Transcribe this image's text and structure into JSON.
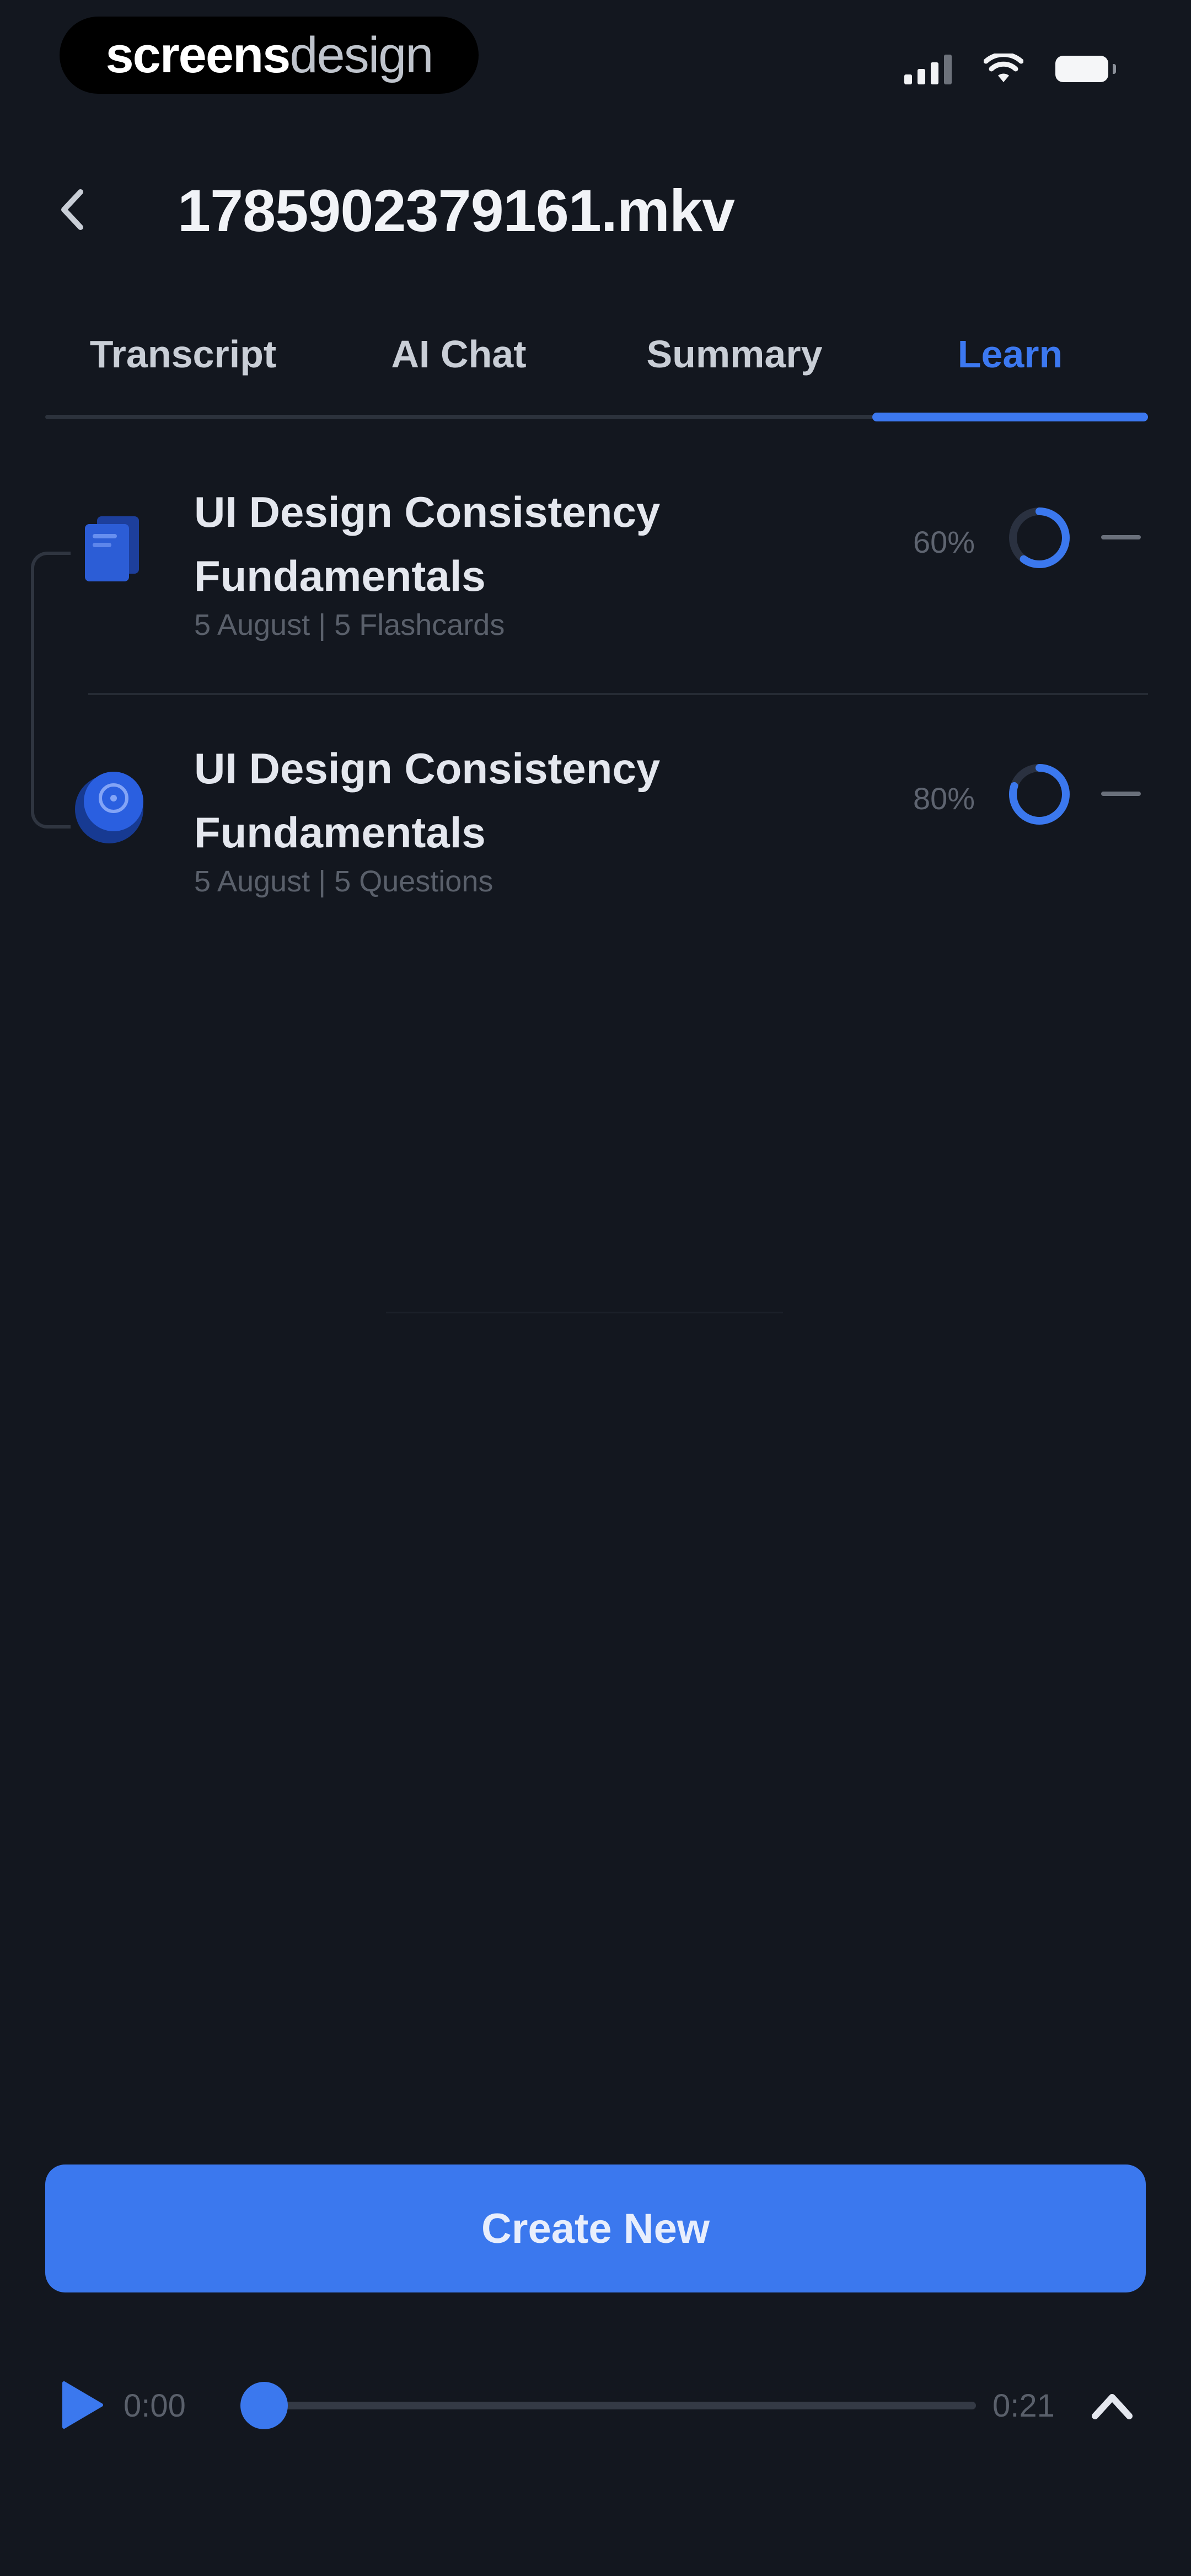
{
  "status_bar": {
    "brand_part1": "screens",
    "brand_part2": "design",
    "icons": [
      "signal-icon",
      "wifi-icon",
      "battery-icon"
    ]
  },
  "header": {
    "back_icon": "chevron-left-icon",
    "title": "1785902379161.mkv"
  },
  "tabs": [
    {
      "label": "Transcript",
      "active": false
    },
    {
      "label": "AI Chat",
      "active": false
    },
    {
      "label": "Summary",
      "active": false
    },
    {
      "label": "Learn",
      "active": true
    }
  ],
  "items": [
    {
      "icon": "flashcards-icon",
      "title": "UI Design Consistency Fundamentals",
      "meta": "5 August | 5 Flashcards",
      "percent": "60%",
      "progress": 0.6,
      "more_icon": "more-icon"
    },
    {
      "icon": "quiz-icon",
      "title": "UI Design Consistency Fundamentals",
      "meta": "5 August | 5 Questions",
      "percent": "80%",
      "progress": 0.8,
      "more_icon": "more-icon"
    }
  ],
  "actions": {
    "create_label": "Create New"
  },
  "player": {
    "play_icon": "play-icon",
    "current_time": "0:00",
    "duration": "0:21",
    "progress": 0,
    "expand_icon": "chevron-up-icon"
  },
  "colors": {
    "background": "#13171f",
    "accent": "#3b78ee",
    "text_primary": "#e4e7ee",
    "text_muted": "#5a606b"
  }
}
